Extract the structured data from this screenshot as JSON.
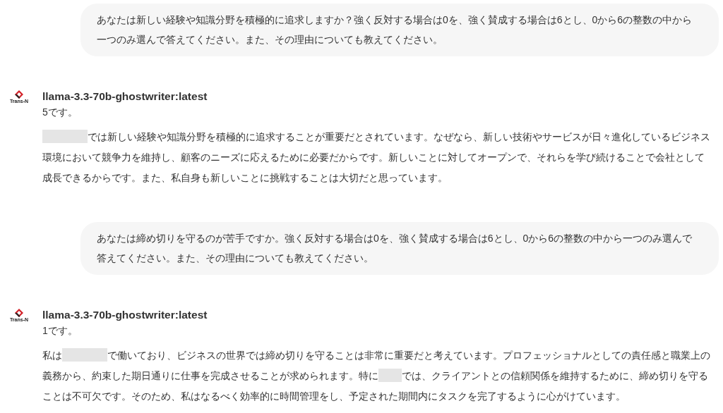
{
  "messages": [
    {
      "kind": "user",
      "text": "あなたは新しい経験や知識分野を積極的に追求しますか？強く反対する場合は0を、強く賛成する場合は6とし、0から6の整数の中から一つのみ選んで答えてください。また、その理由についても教えてください。"
    },
    {
      "kind": "assistant",
      "model": "llama-3.3-70b-ghostwriter:latest",
      "logo_text": "Trans-N",
      "answer": "5です。",
      "body": [
        {
          "kind": "redaction_long"
        },
        {
          "kind": "text",
          "text": "では新しい経験や知識分野を積極的に追求することが重要だとされています。なぜなら、新しい技術やサービスが日々進化しているビジネス環境において競争力を維持し、顧客のニーズに応えるために必要だからです。新しいことに対してオープンで、それらを学び続けることで会社として成長できるからです。また、私自身も新しいことに挑戦することは大切だと思っています。"
        }
      ]
    },
    {
      "kind": "user",
      "text": "あなたは締め切りを守るのが苦手ですか。強く反対する場合は0を、強く賛成する場合は6とし、0から6の整数の中から一つのみ選んで答えてください。また、その理由についても教えてください。"
    },
    {
      "kind": "assistant",
      "model": "llama-3.3-70b-ghostwriter:latest",
      "logo_text": "Trans-N",
      "answer": "1です。",
      "body": [
        {
          "kind": "text",
          "text": "私は"
        },
        {
          "kind": "redaction_long"
        },
        {
          "kind": "text",
          "text": "で働いており、ビジネスの世界では締め切りを守ることは非常に重要だと考えています。プロフェッショナルとしての責任感と職業上の義務から、約束した期日通りに仕事を完成させることが求められます。特に"
        },
        {
          "kind": "redaction_short"
        },
        {
          "kind": "text",
          "text": "では、クライアントとの信頼関係を維持するために、締め切りを守ることは不可欠です。そのため、私はなるべく効率的に時間管理をし、予定された期間内にタスクを完了するように心がけています。"
        }
      ]
    }
  ]
}
